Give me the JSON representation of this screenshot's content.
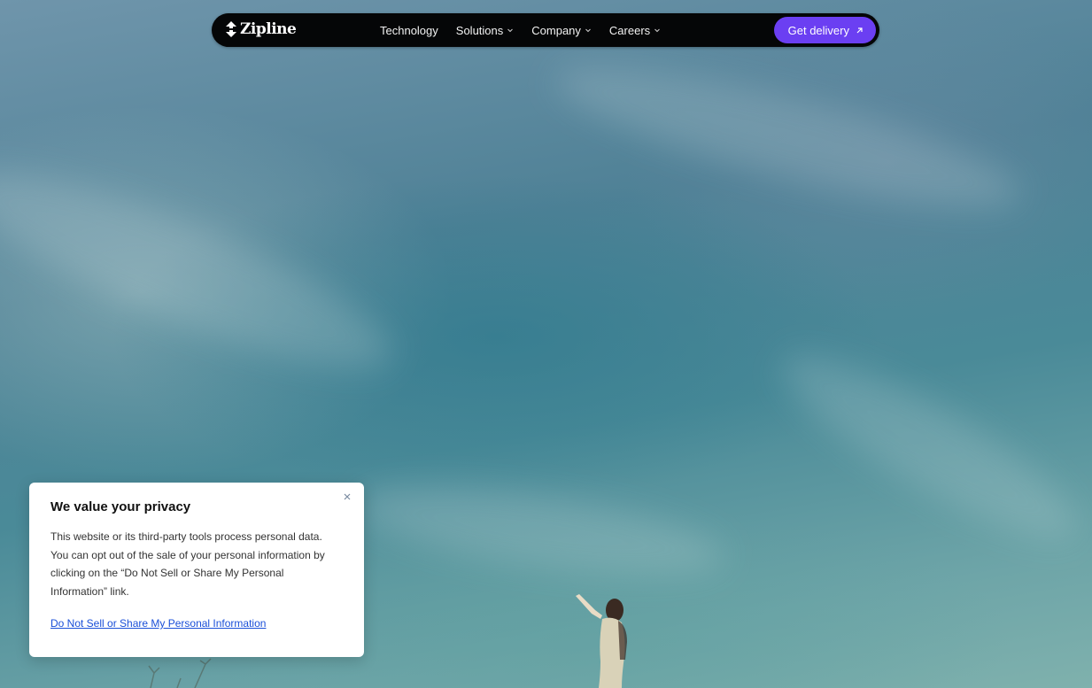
{
  "navbar": {
    "brand": "Zipline",
    "links": [
      {
        "label": "Technology",
        "has_dropdown": false
      },
      {
        "label": "Solutions",
        "has_dropdown": true
      },
      {
        "label": "Company",
        "has_dropdown": true
      },
      {
        "label": "Careers",
        "has_dropdown": true
      }
    ],
    "cta_label": "Get delivery",
    "cta_icon": "arrow-up-right-icon",
    "colors": {
      "bar": "#050607",
      "cta": "#6b3ff2"
    }
  },
  "privacy_popup": {
    "title": "We value your privacy",
    "body": "This website or its third-party tools process personal data. You can opt out of the sale of your personal information by clicking on the “Do Not Sell or Share My Personal Information” link.",
    "link_label": "Do Not Sell or Share My Personal Information",
    "close_icon": "close-icon",
    "colors": {
      "link": "#1a4fd8"
    }
  }
}
